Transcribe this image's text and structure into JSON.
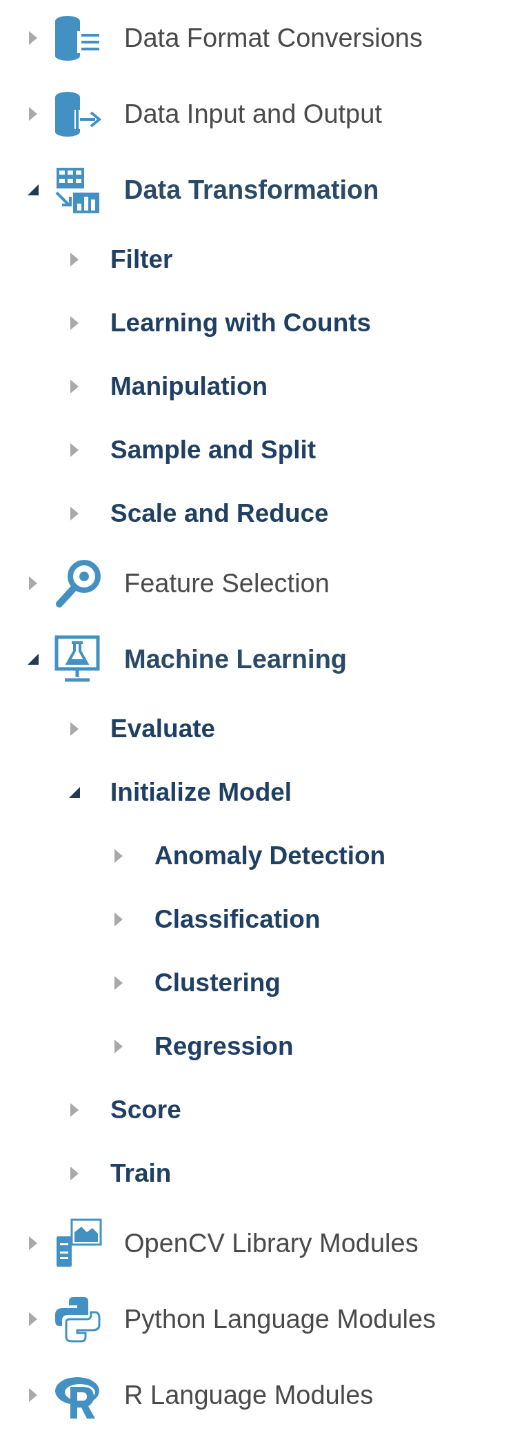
{
  "tree": [
    {
      "label": "Data Format Conversions",
      "expanded": false
    },
    {
      "label": "Data Input and Output",
      "expanded": false
    },
    {
      "label": "Data Transformation",
      "expanded": true,
      "children": [
        {
          "label": "Filter",
          "expanded": false
        },
        {
          "label": "Learning with Counts",
          "expanded": false
        },
        {
          "label": "Manipulation",
          "expanded": false
        },
        {
          "label": "Sample and Split",
          "expanded": false
        },
        {
          "label": "Scale and Reduce",
          "expanded": false
        }
      ]
    },
    {
      "label": "Feature Selection",
      "expanded": false
    },
    {
      "label": "Machine Learning",
      "expanded": true,
      "children": [
        {
          "label": "Evaluate",
          "expanded": false
        },
        {
          "label": "Initialize Model",
          "expanded": true,
          "children": [
            {
              "label": "Anomaly Detection",
              "expanded": false
            },
            {
              "label": "Classification",
              "expanded": false
            },
            {
              "label": "Clustering",
              "expanded": false
            },
            {
              "label": "Regression",
              "expanded": false
            }
          ]
        },
        {
          "label": "Score",
          "expanded": false
        },
        {
          "label": "Train",
          "expanded": false
        }
      ]
    },
    {
      "label": "OpenCV Library Modules",
      "expanded": false
    },
    {
      "label": "Python Language Modules",
      "expanded": false
    },
    {
      "label": "R Language Modules",
      "expanded": false
    }
  ]
}
